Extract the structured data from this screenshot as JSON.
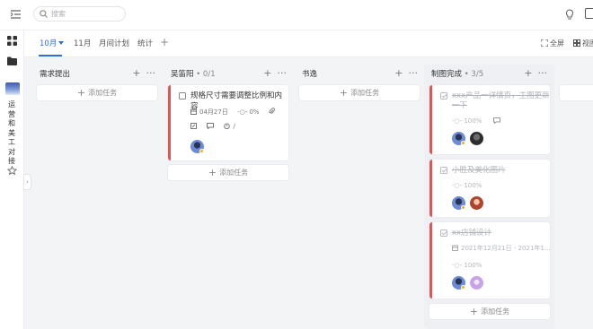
{
  "search": {
    "placeholder": "搜索"
  },
  "sidebar": {
    "project_name": "运营和美工对接"
  },
  "tabs": [
    {
      "label": "10月",
      "active": true
    },
    {
      "label": "11月"
    },
    {
      "label": "月间计划"
    },
    {
      "label": "统计"
    }
  ],
  "toolbar": {
    "fullscreen_label": "全屏",
    "view_label": "视图"
  },
  "add_task_label": "添加任务",
  "columns": [
    {
      "title": "需求提出",
      "count": ""
    },
    {
      "title": "吴笛阳",
      "count": " • 0/1"
    },
    {
      "title": "书逸",
      "count": ""
    },
    {
      "title": "制图完成",
      "count": " • 3/5"
    }
  ],
  "cards": {
    "c1": {
      "title": "规格尺寸需要调整比例和内容",
      "date": "04月27日",
      "progress": "0%",
      "timer": "/"
    },
    "c2": {
      "title_line1": "xxx产品一详情页，主图更新",
      "title_line2": "一下",
      "progress": "100%"
    },
    "c3": {
      "title": "小胜及美化图片",
      "progress": "100%"
    },
    "c4": {
      "title": "xx店铺设计",
      "date": "2021年12月21日 - 2021年1...",
      "progress": "100%"
    }
  },
  "colors": {
    "accent": "#2f6fdc",
    "card_stripe": "#e05656"
  }
}
